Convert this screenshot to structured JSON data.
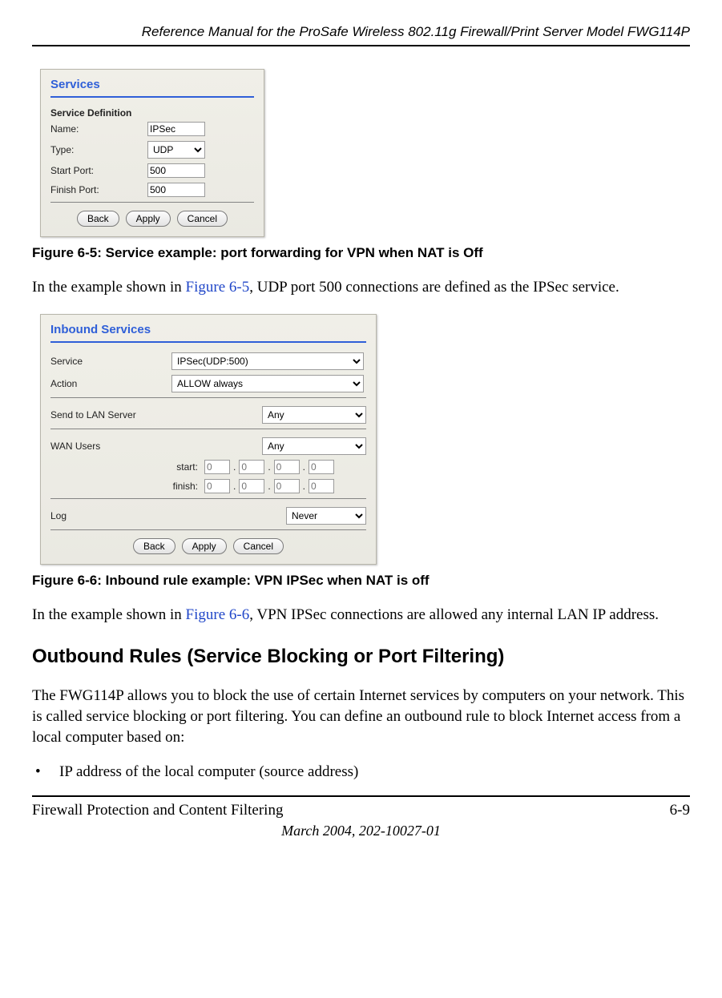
{
  "header": {
    "title": "Reference Manual for the ProSafe Wireless 802.11g  Firewall/Print Server Model FWG114P"
  },
  "fig1": {
    "panel_title": "Services",
    "section": "Service Definition",
    "name_label": "Name:",
    "name_value": "IPSec",
    "type_label": "Type:",
    "type_value": "UDP",
    "start_label": "Start Port:",
    "start_value": "500",
    "finish_label": "Finish Port:",
    "finish_value": "500",
    "btn_back": "Back",
    "btn_apply": "Apply",
    "btn_cancel": "Cancel",
    "caption": "Figure 6-5:  Service example: port forwarding for VPN when NAT is Off"
  },
  "para1": {
    "pre": "In the example shown in ",
    "link": "Figure 6-5",
    "post": ", UDP port 500 connections are defined as the IPSec service."
  },
  "fig2": {
    "panel_title": "Inbound Services",
    "service_label": "Service",
    "service_value": "IPSec(UDP:500)",
    "action_label": "Action",
    "action_value": "ALLOW always",
    "send_label": "Send to LAN Server",
    "send_value": "Any",
    "wan_label": "WAN Users",
    "wan_value": "Any",
    "ip_start_label": "start:",
    "ip_finish_label": "finish:",
    "ip_octet_placeholder": "0",
    "log_label": "Log",
    "log_value": "Never",
    "btn_back": "Back",
    "btn_apply": "Apply",
    "btn_cancel": "Cancel",
    "caption_a": "Figure 6-6:  Inbound rule example: ",
    "caption_b": "VPN IPSec when NAT is off"
  },
  "para2": {
    "pre": "In the example shown in ",
    "link": "Figure 6-6",
    "post": ", VPN IPSec connections are allowed any internal LAN IP address."
  },
  "h2": "Outbound Rules (Service Blocking or Port Filtering)",
  "para3": "The FWG114P allows you to block the use of certain Internet services by computers on your network. This is called service blocking or port filtering. You can define an outbound rule to block Internet access from a local computer based on:",
  "bullet1": "IP address of the local computer (source address)",
  "footer": {
    "left": "Firewall Protection and Content Filtering",
    "right": "6-9",
    "date": "March 2004, 202-10027-01"
  }
}
